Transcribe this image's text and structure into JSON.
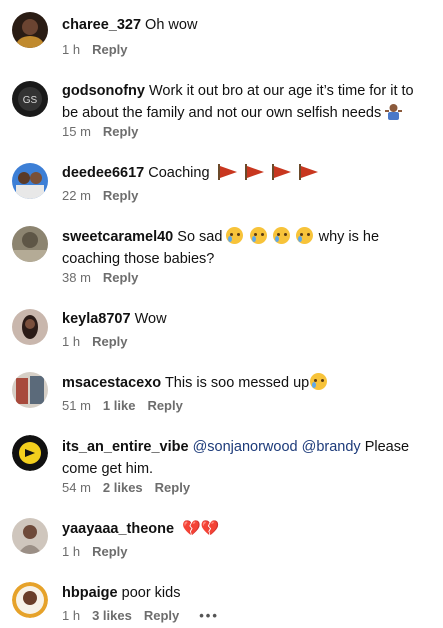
{
  "comments": [
    {
      "username": "charee_327",
      "text": "Oh wow",
      "time": "1 h",
      "likes": "",
      "reply": "Reply"
    },
    {
      "username": "godsonofny",
      "text": "Work it out bro at our age it’s time for it to be about the family and not our own selfish needs",
      "time": "15 m",
      "likes": "",
      "reply": "Reply"
    },
    {
      "username": "deedee6617",
      "text": "Coaching",
      "time": "22 m",
      "likes": "",
      "reply": "Reply"
    },
    {
      "username": "sweetcaramel40",
      "text": "So sad",
      "text2": "why is he coaching those babies?",
      "time": "38 m",
      "likes": "",
      "reply": "Reply"
    },
    {
      "username": "keyla8707",
      "text": "Wow",
      "time": "1 h",
      "likes": "",
      "reply": "Reply"
    },
    {
      "username": "msacestacexo",
      "text": "This is soo messed up",
      "time": "51 m",
      "likes": "1 like",
      "reply": "Reply"
    },
    {
      "username": "its_an_entire_vibe",
      "mention1": "@sonjanorwood",
      "mention2": "@brandy",
      "text": "Please come get him.",
      "time": "54 m",
      "likes": "2 likes",
      "reply": "Reply"
    },
    {
      "username": "yaayaaa_theone",
      "text": "",
      "time": "1 h",
      "likes": "",
      "reply": "Reply"
    },
    {
      "username": "hbpaige",
      "text": "poor kids",
      "time": "1 h",
      "likes": "3 likes",
      "reply": "Reply",
      "more": "•••"
    }
  ],
  "icons": {
    "avatar": "profile-avatar-icon",
    "shrug": "person-shrugging-emoji",
    "flag": "triangular-flag-emoji",
    "cry": "crying-face-emoji",
    "heart": "broken-heart-emoji"
  }
}
